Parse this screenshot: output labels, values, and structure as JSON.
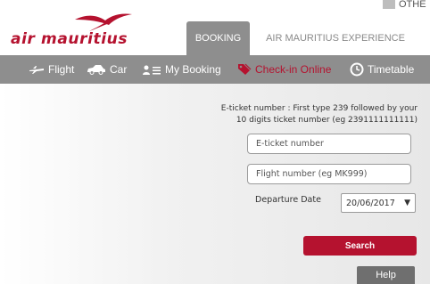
{
  "header": {
    "logo_text": "air mauritius",
    "language": "OTHE",
    "tabs": [
      {
        "label": "BOOKING",
        "active": true
      },
      {
        "label": "AIR MAURITIUS EXPERIENCE",
        "active": false
      }
    ]
  },
  "nav": {
    "items": [
      {
        "label": "Flight",
        "icon": "plane-icon"
      },
      {
        "label": "Car",
        "icon": "car-icon"
      },
      {
        "label": "My Booking",
        "icon": "person-list-icon"
      },
      {
        "label": "Check-in Online",
        "icon": "tag-icon",
        "active": true
      },
      {
        "label": "Timetable",
        "icon": "clock-icon"
      }
    ]
  },
  "form": {
    "instruction_line1": "E-ticket number : First type 239 followed by your",
    "instruction_line2": "10 digits ticket number (eg 2391111111111)",
    "eticket_placeholder": "E-ticket number",
    "flight_placeholder": "Flight number (eg MK999)",
    "departure_label": "Departure Date",
    "departure_value": "20/06/2017",
    "search_label": "Search",
    "help_label": "Help"
  },
  "colors": {
    "brand": "#b5122f",
    "nav_bg": "#8e8e8e",
    "help_bg": "#6f6f6f"
  }
}
